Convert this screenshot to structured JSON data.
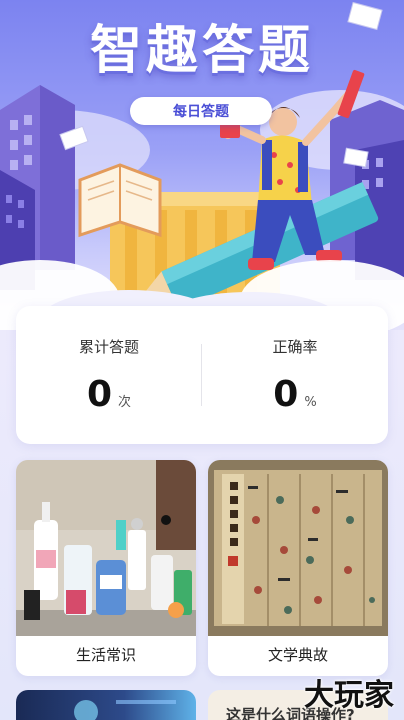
{
  "hero": {
    "title": "智趣答题",
    "badge": "每日答题"
  },
  "stats": {
    "total": {
      "label": "累计答题",
      "value": "0",
      "unit": "次"
    },
    "accuracy": {
      "label": "正确率",
      "value": "0",
      "unit": "%"
    }
  },
  "categories": [
    {
      "label": "生活常识",
      "image_icon": "toiletries-photo"
    },
    {
      "label": "文学典故",
      "image_icon": "ancient-scroll-painting"
    }
  ],
  "bottom_cards": [
    {
      "label": "",
      "image_icon": "tech-dark-banner"
    },
    {
      "label": "这是什么词语操作?",
      "image_icon": "text-card"
    }
  ],
  "watermark": "大玩家",
  "colors": {
    "hero_primary": "#7c83f0",
    "badge_text": "#4b4fd6",
    "card_bg": "#ffffff",
    "page_bg": "#e9e7fb"
  }
}
